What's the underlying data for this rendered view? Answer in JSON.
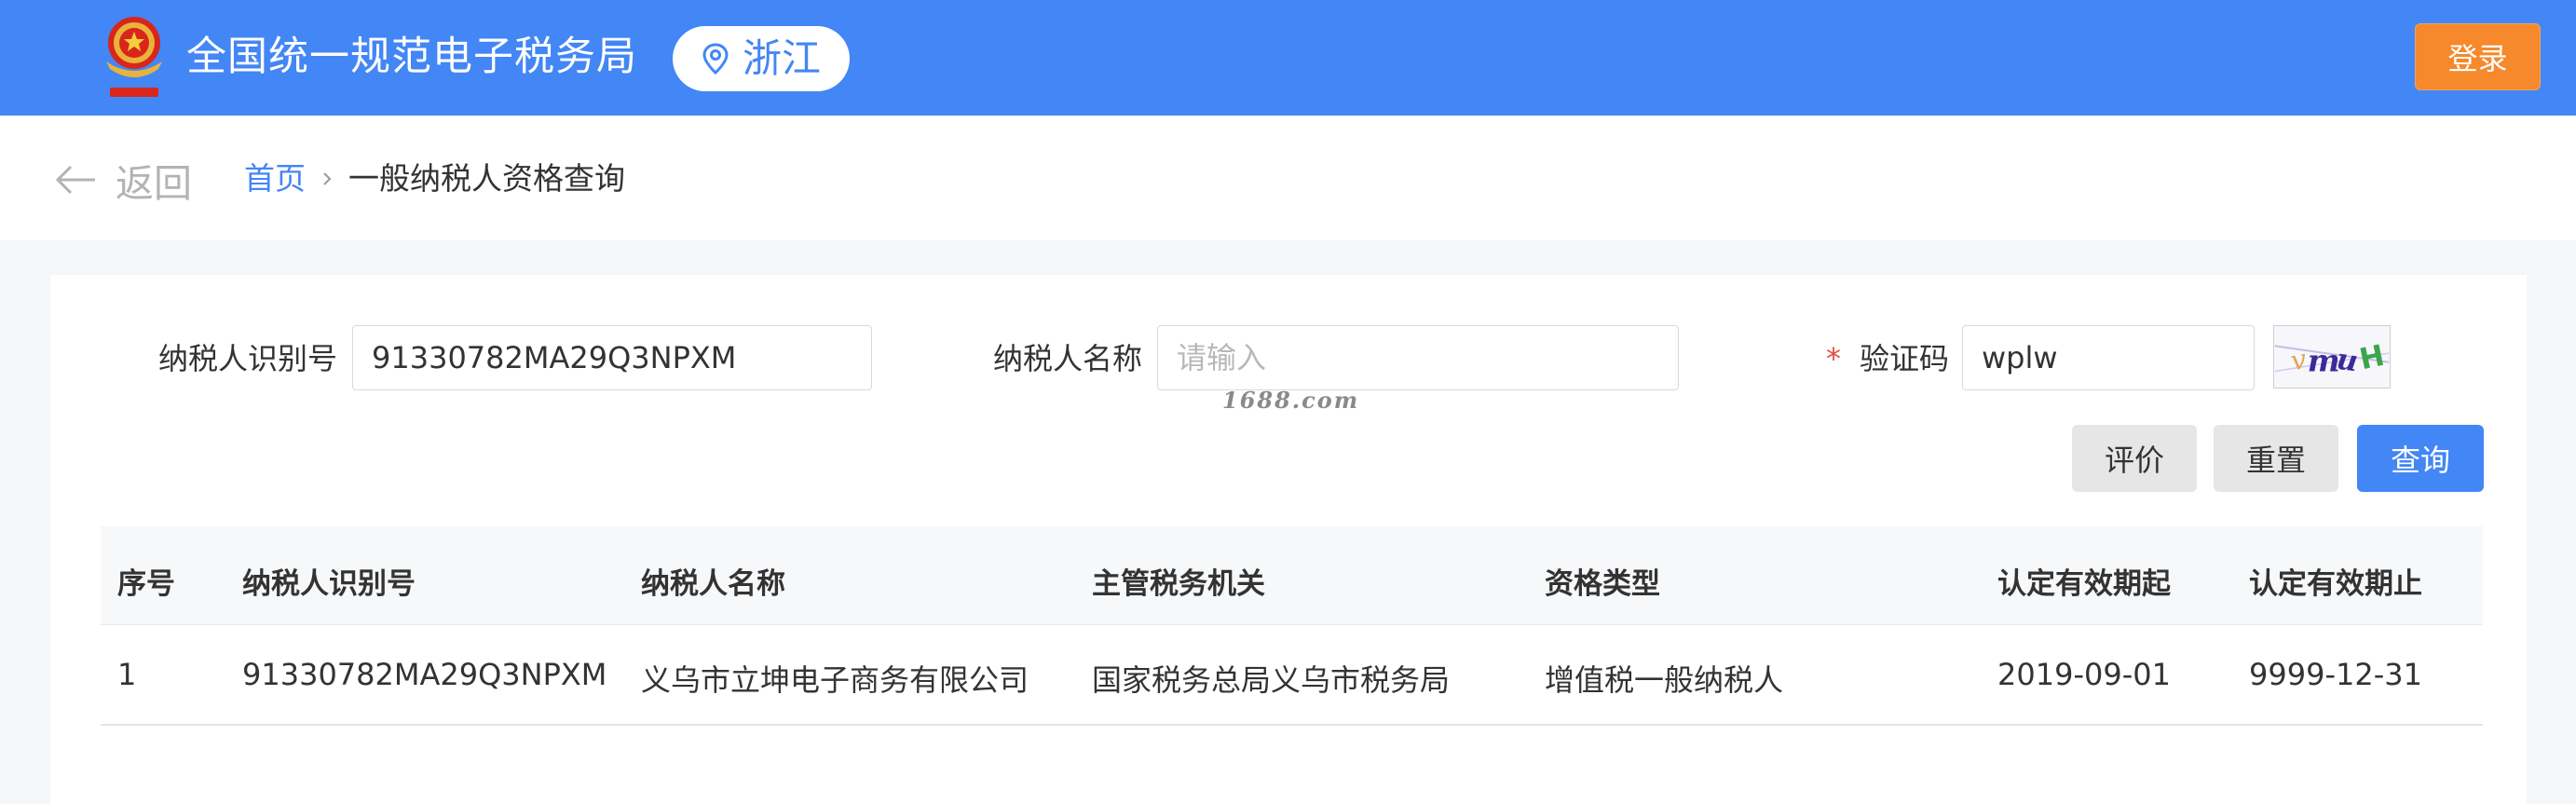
{
  "header": {
    "site_title": "全国统一规范电子税务局",
    "region": "浙江",
    "login_label": "登录"
  },
  "nav": {
    "back_label": "返回",
    "home_label": "首页",
    "current_label": "一般纳税人资格查询"
  },
  "form": {
    "taxpayer_id_label": "纳税人识别号",
    "taxpayer_id_value": "91330782MA29Q3NPXM",
    "taxpayer_name_label": "纳税人名称",
    "taxpayer_name_placeholder": "请输入",
    "captcha_required": "*",
    "captcha_label": "验证码",
    "captcha_value": "wplw",
    "captcha_image_text": "vmuH",
    "watermark": "1688.com",
    "buttons": {
      "evaluate": "评价",
      "reset": "重置",
      "query": "查询"
    }
  },
  "table": {
    "columns": [
      "序号",
      "纳税人识别号",
      "纳税人名称",
      "主管税务机关",
      "资格类型",
      "认定有效期起",
      "认定有效期止"
    ],
    "rows": [
      [
        "1",
        "91330782MA29Q3NPXM",
        "义乌市立坤电子商务有限公司",
        "国家税务总局义乌市税务局",
        "增值税一般纳税人",
        "2019-09-01",
        "9999-12-31"
      ]
    ]
  },
  "colors": {
    "brand_blue": "#4386f5",
    "login_orange": "#f5892b"
  }
}
